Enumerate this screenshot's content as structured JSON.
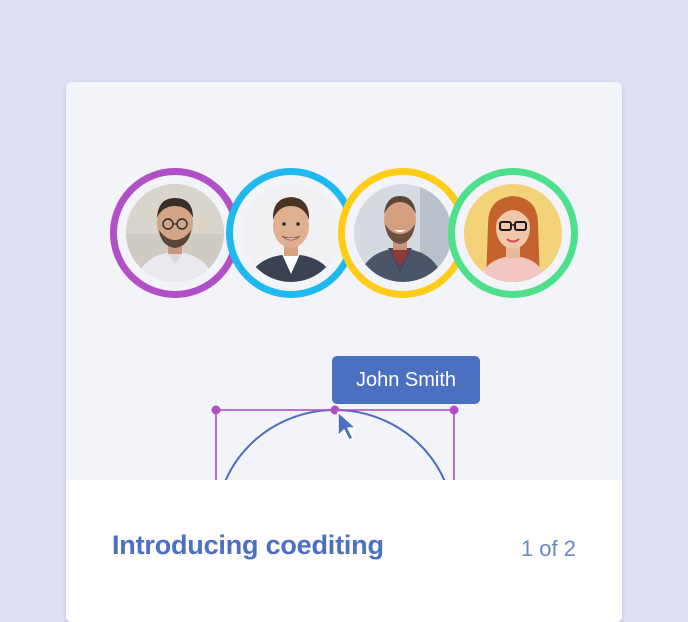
{
  "colors": {
    "page_bg": "#dde1f2",
    "accent": "#4b6fc1",
    "selection": "#b04fc6",
    "ring_1": "#b04fc6",
    "ring_2": "#1fb8ef",
    "ring_3": "#ffcc17",
    "ring_4": "#4ee08c"
  },
  "avatars": [
    {
      "ring": "purple",
      "subject": "man-glasses-beard"
    },
    {
      "ring": "cyan",
      "subject": "man-smiling-suit"
    },
    {
      "ring": "yellow",
      "subject": "man-beard-coat"
    },
    {
      "ring": "green",
      "subject": "woman-glasses-red-hair"
    }
  ],
  "tooltip": {
    "label": "John Smith"
  },
  "footer": {
    "title": "Introducing coediting",
    "pager": "1 of 2"
  }
}
